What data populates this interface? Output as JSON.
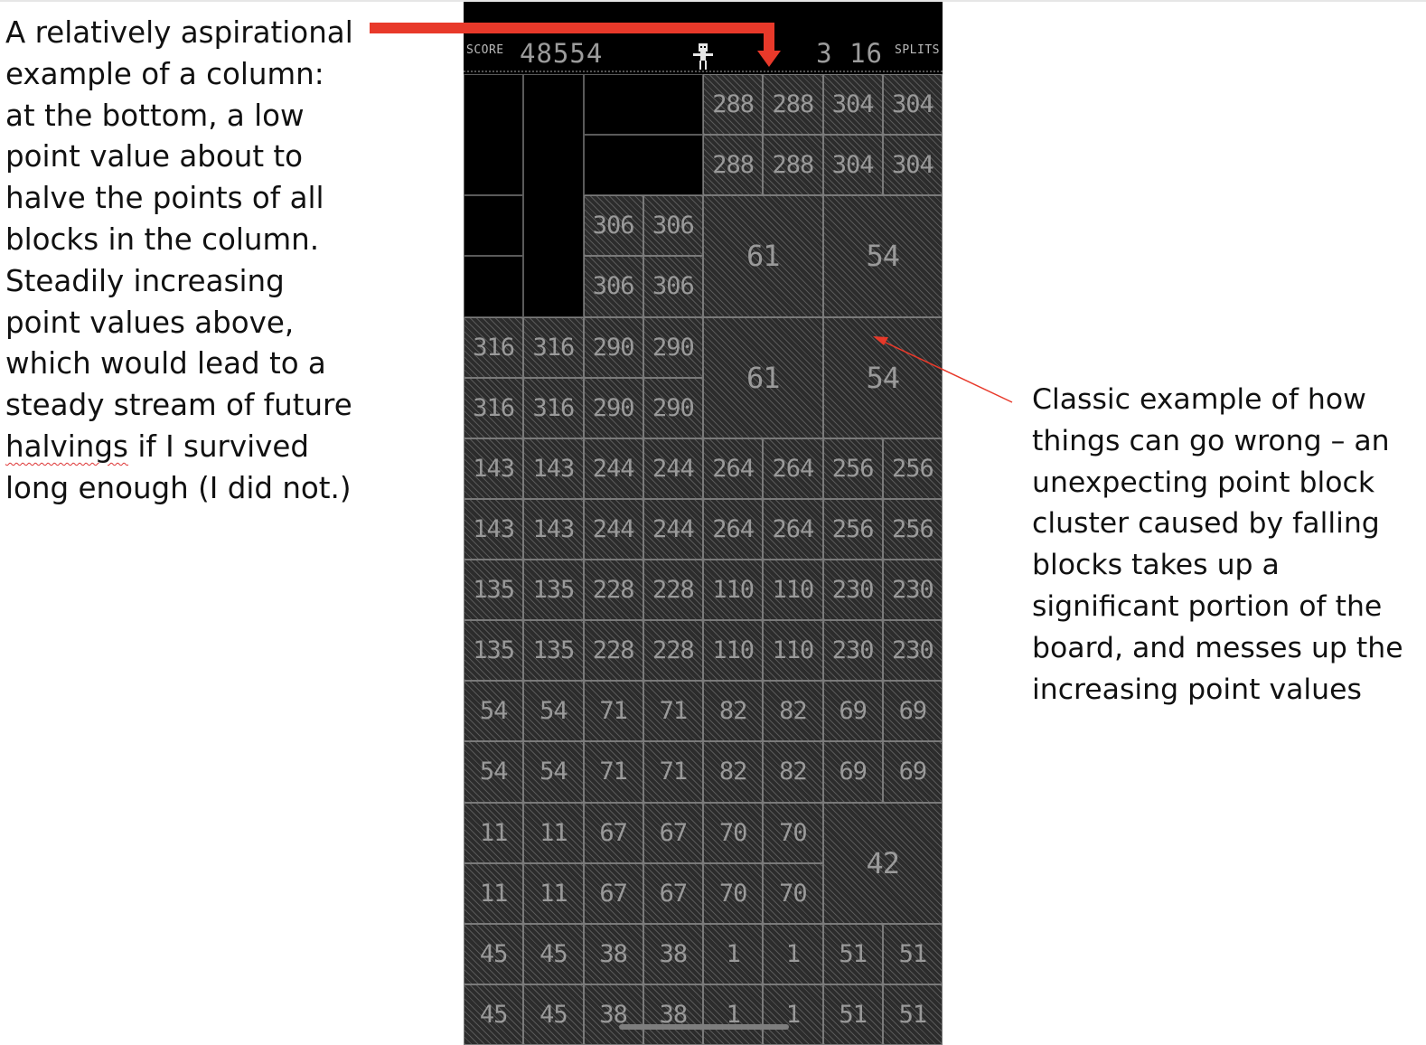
{
  "annotations": {
    "left": "A relatively aspirational example of a column: at the bottom, a low point value about to halve the points of all blocks in the column. Steadily increasing point values above, which would lead to a steady stream of future",
    "left_flagged_word": "halvings",
    "left_tail": "if I survived long enough (I did not.)",
    "right": "Classic example of how things can go wrong – an unexpecting point block cluster caused by falling blocks takes up a significant portion of the board, and messes up the increasing point values"
  },
  "hud": {
    "score_label": "SCORE",
    "score_value": "48554",
    "splits_value": "3 16",
    "splits_label": "SPLITS"
  },
  "board": {
    "cells": [
      {
        "c": 0,
        "r": 2,
        "w": 1,
        "h": 1,
        "v": "",
        "empty": true
      },
      {
        "c": 0,
        "r": 3,
        "w": 1,
        "h": 1,
        "v": "",
        "empty": true
      },
      {
        "c": 0,
        "r": 0,
        "w": 1,
        "h": 2,
        "v": "",
        "empty": true
      },
      {
        "c": 1,
        "r": 0,
        "w": 1,
        "h": 4,
        "v": "",
        "empty": true
      },
      {
        "c": 2,
        "r": 0,
        "w": 2,
        "h": 1,
        "v": "",
        "empty": true
      },
      {
        "c": 2,
        "r": 1,
        "w": 2,
        "h": 1,
        "v": "",
        "empty": true
      },
      {
        "c": 4,
        "r": 0,
        "w": 1,
        "h": 1,
        "v": "288"
      },
      {
        "c": 5,
        "r": 0,
        "w": 1,
        "h": 1,
        "v": "288"
      },
      {
        "c": 6,
        "r": 0,
        "w": 1,
        "h": 1,
        "v": "304"
      },
      {
        "c": 7,
        "r": 0,
        "w": 1,
        "h": 1,
        "v": "304"
      },
      {
        "c": 4,
        "r": 1,
        "w": 1,
        "h": 1,
        "v": "288"
      },
      {
        "c": 5,
        "r": 1,
        "w": 1,
        "h": 1,
        "v": "288"
      },
      {
        "c": 6,
        "r": 1,
        "w": 1,
        "h": 1,
        "v": "304"
      },
      {
        "c": 7,
        "r": 1,
        "w": 1,
        "h": 1,
        "v": "304"
      },
      {
        "c": 2,
        "r": 2,
        "w": 1,
        "h": 1,
        "v": "306"
      },
      {
        "c": 3,
        "r": 2,
        "w": 1,
        "h": 1,
        "v": "306"
      },
      {
        "c": 2,
        "r": 3,
        "w": 1,
        "h": 1,
        "v": "306"
      },
      {
        "c": 3,
        "r": 3,
        "w": 1,
        "h": 1,
        "v": "306"
      },
      {
        "c": 4,
        "r": 2,
        "w": 2,
        "h": 2,
        "v": "61"
      },
      {
        "c": 6,
        "r": 2,
        "w": 2,
        "h": 2,
        "v": "54"
      },
      {
        "c": 0,
        "r": 4,
        "w": 1,
        "h": 1,
        "v": "316"
      },
      {
        "c": 1,
        "r": 4,
        "w": 1,
        "h": 1,
        "v": "316"
      },
      {
        "c": 2,
        "r": 4,
        "w": 1,
        "h": 1,
        "v": "290"
      },
      {
        "c": 3,
        "r": 4,
        "w": 1,
        "h": 1,
        "v": "290"
      },
      {
        "c": 0,
        "r": 5,
        "w": 1,
        "h": 1,
        "v": "316"
      },
      {
        "c": 1,
        "r": 5,
        "w": 1,
        "h": 1,
        "v": "316"
      },
      {
        "c": 2,
        "r": 5,
        "w": 1,
        "h": 1,
        "v": "290"
      },
      {
        "c": 3,
        "r": 5,
        "w": 1,
        "h": 1,
        "v": "290"
      },
      {
        "c": 4,
        "r": 4,
        "w": 2,
        "h": 2,
        "v": "61"
      },
      {
        "c": 6,
        "r": 4,
        "w": 2,
        "h": 2,
        "v": "54"
      },
      {
        "c": 0,
        "r": 6,
        "w": 1,
        "h": 1,
        "v": "143"
      },
      {
        "c": 1,
        "r": 6,
        "w": 1,
        "h": 1,
        "v": "143"
      },
      {
        "c": 2,
        "r": 6,
        "w": 1,
        "h": 1,
        "v": "244"
      },
      {
        "c": 3,
        "r": 6,
        "w": 1,
        "h": 1,
        "v": "244"
      },
      {
        "c": 4,
        "r": 6,
        "w": 1,
        "h": 1,
        "v": "264"
      },
      {
        "c": 5,
        "r": 6,
        "w": 1,
        "h": 1,
        "v": "264"
      },
      {
        "c": 6,
        "r": 6,
        "w": 1,
        "h": 1,
        "v": "256"
      },
      {
        "c": 7,
        "r": 6,
        "w": 1,
        "h": 1,
        "v": "256"
      },
      {
        "c": 0,
        "r": 7,
        "w": 1,
        "h": 1,
        "v": "143"
      },
      {
        "c": 1,
        "r": 7,
        "w": 1,
        "h": 1,
        "v": "143"
      },
      {
        "c": 2,
        "r": 7,
        "w": 1,
        "h": 1,
        "v": "244"
      },
      {
        "c": 3,
        "r": 7,
        "w": 1,
        "h": 1,
        "v": "244"
      },
      {
        "c": 4,
        "r": 7,
        "w": 1,
        "h": 1,
        "v": "264"
      },
      {
        "c": 5,
        "r": 7,
        "w": 1,
        "h": 1,
        "v": "264"
      },
      {
        "c": 6,
        "r": 7,
        "w": 1,
        "h": 1,
        "v": "256"
      },
      {
        "c": 7,
        "r": 7,
        "w": 1,
        "h": 1,
        "v": "256"
      },
      {
        "c": 0,
        "r": 8,
        "w": 1,
        "h": 1,
        "v": "135"
      },
      {
        "c": 1,
        "r": 8,
        "w": 1,
        "h": 1,
        "v": "135"
      },
      {
        "c": 2,
        "r": 8,
        "w": 1,
        "h": 1,
        "v": "228"
      },
      {
        "c": 3,
        "r": 8,
        "w": 1,
        "h": 1,
        "v": "228"
      },
      {
        "c": 4,
        "r": 8,
        "w": 1,
        "h": 1,
        "v": "110"
      },
      {
        "c": 5,
        "r": 8,
        "w": 1,
        "h": 1,
        "v": "110"
      },
      {
        "c": 6,
        "r": 8,
        "w": 1,
        "h": 1,
        "v": "230"
      },
      {
        "c": 7,
        "r": 8,
        "w": 1,
        "h": 1,
        "v": "230"
      },
      {
        "c": 0,
        "r": 9,
        "w": 1,
        "h": 1,
        "v": "135"
      },
      {
        "c": 1,
        "r": 9,
        "w": 1,
        "h": 1,
        "v": "135"
      },
      {
        "c": 2,
        "r": 9,
        "w": 1,
        "h": 1,
        "v": "228"
      },
      {
        "c": 3,
        "r": 9,
        "w": 1,
        "h": 1,
        "v": "228"
      },
      {
        "c": 4,
        "r": 9,
        "w": 1,
        "h": 1,
        "v": "110"
      },
      {
        "c": 5,
        "r": 9,
        "w": 1,
        "h": 1,
        "v": "110"
      },
      {
        "c": 6,
        "r": 9,
        "w": 1,
        "h": 1,
        "v": "230"
      },
      {
        "c": 7,
        "r": 9,
        "w": 1,
        "h": 1,
        "v": "230"
      },
      {
        "c": 0,
        "r": 10,
        "w": 1,
        "h": 1,
        "v": "54"
      },
      {
        "c": 1,
        "r": 10,
        "w": 1,
        "h": 1,
        "v": "54"
      },
      {
        "c": 2,
        "r": 10,
        "w": 1,
        "h": 1,
        "v": "71"
      },
      {
        "c": 3,
        "r": 10,
        "w": 1,
        "h": 1,
        "v": "71"
      },
      {
        "c": 4,
        "r": 10,
        "w": 1,
        "h": 1,
        "v": "82"
      },
      {
        "c": 5,
        "r": 10,
        "w": 1,
        "h": 1,
        "v": "82"
      },
      {
        "c": 6,
        "r": 10,
        "w": 1,
        "h": 1,
        "v": "69"
      },
      {
        "c": 7,
        "r": 10,
        "w": 1,
        "h": 1,
        "v": "69"
      },
      {
        "c": 0,
        "r": 11,
        "w": 1,
        "h": 1,
        "v": "54"
      },
      {
        "c": 1,
        "r": 11,
        "w": 1,
        "h": 1,
        "v": "54"
      },
      {
        "c": 2,
        "r": 11,
        "w": 1,
        "h": 1,
        "v": "71"
      },
      {
        "c": 3,
        "r": 11,
        "w": 1,
        "h": 1,
        "v": "71"
      },
      {
        "c": 4,
        "r": 11,
        "w": 1,
        "h": 1,
        "v": "82"
      },
      {
        "c": 5,
        "r": 11,
        "w": 1,
        "h": 1,
        "v": "82"
      },
      {
        "c": 6,
        "r": 11,
        "w": 1,
        "h": 1,
        "v": "69"
      },
      {
        "c": 7,
        "r": 11,
        "w": 1,
        "h": 1,
        "v": "69"
      },
      {
        "c": 0,
        "r": 12,
        "w": 1,
        "h": 1,
        "v": "11"
      },
      {
        "c": 1,
        "r": 12,
        "w": 1,
        "h": 1,
        "v": "11"
      },
      {
        "c": 2,
        "r": 12,
        "w": 1,
        "h": 1,
        "v": "67"
      },
      {
        "c": 3,
        "r": 12,
        "w": 1,
        "h": 1,
        "v": "67"
      },
      {
        "c": 4,
        "r": 12,
        "w": 1,
        "h": 1,
        "v": "70"
      },
      {
        "c": 5,
        "r": 12,
        "w": 1,
        "h": 1,
        "v": "70"
      },
      {
        "c": 6,
        "r": 12,
        "w": 2,
        "h": 2,
        "v": "42"
      },
      {
        "c": 0,
        "r": 13,
        "w": 1,
        "h": 1,
        "v": "11"
      },
      {
        "c": 1,
        "r": 13,
        "w": 1,
        "h": 1,
        "v": "11"
      },
      {
        "c": 2,
        "r": 13,
        "w": 1,
        "h": 1,
        "v": "67"
      },
      {
        "c": 3,
        "r": 13,
        "w": 1,
        "h": 1,
        "v": "67"
      },
      {
        "c": 4,
        "r": 13,
        "w": 1,
        "h": 1,
        "v": "70"
      },
      {
        "c": 5,
        "r": 13,
        "w": 1,
        "h": 1,
        "v": "70"
      },
      {
        "c": 0,
        "r": 14,
        "w": 1,
        "h": 1,
        "v": "45"
      },
      {
        "c": 1,
        "r": 14,
        "w": 1,
        "h": 1,
        "v": "45"
      },
      {
        "c": 2,
        "r": 14,
        "w": 1,
        "h": 1,
        "v": "38"
      },
      {
        "c": 3,
        "r": 14,
        "w": 1,
        "h": 1,
        "v": "38"
      },
      {
        "c": 4,
        "r": 14,
        "w": 1,
        "h": 1,
        "v": "1"
      },
      {
        "c": 5,
        "r": 14,
        "w": 1,
        "h": 1,
        "v": "1"
      },
      {
        "c": 6,
        "r": 14,
        "w": 1,
        "h": 1,
        "v": "51"
      },
      {
        "c": 7,
        "r": 14,
        "w": 1,
        "h": 1,
        "v": "51"
      },
      {
        "c": 0,
        "r": 15,
        "w": 1,
        "h": 1,
        "v": "45"
      },
      {
        "c": 1,
        "r": 15,
        "w": 1,
        "h": 1,
        "v": "45"
      },
      {
        "c": 2,
        "r": 15,
        "w": 1,
        "h": 1,
        "v": "38"
      },
      {
        "c": 3,
        "r": 15,
        "w": 1,
        "h": 1,
        "v": "38"
      },
      {
        "c": 4,
        "r": 15,
        "w": 1,
        "h": 1,
        "v": "1"
      },
      {
        "c": 5,
        "r": 15,
        "w": 1,
        "h": 1,
        "v": "1"
      },
      {
        "c": 6,
        "r": 15,
        "w": 1,
        "h": 1,
        "v": "51"
      },
      {
        "c": 7,
        "r": 15,
        "w": 1,
        "h": 1,
        "v": "51"
      }
    ]
  },
  "colors": {
    "arrow_red": "#e8392a",
    "board_bg": "#000000",
    "cell_text": "#9a9a9a"
  }
}
